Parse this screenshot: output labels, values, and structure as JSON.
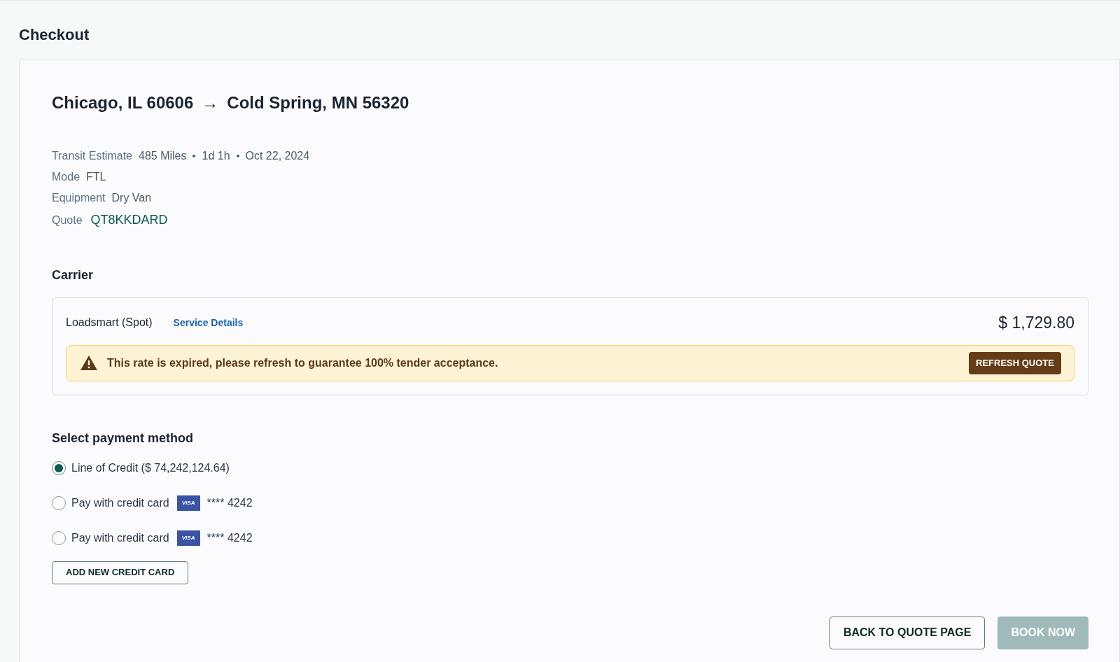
{
  "page_title": "Checkout",
  "route": {
    "origin": "Chicago, IL 60606",
    "arrow": "→",
    "destination": "Cold Spring, MN 56320"
  },
  "details": [
    {
      "label": "Transit Estimate",
      "values": [
        "485 Miles",
        "1d 1h",
        "Oct 22, 2024"
      ],
      "kind": "plain"
    },
    {
      "label": "Mode",
      "values": [
        "FTL"
      ],
      "kind": "plain"
    },
    {
      "label": "Equipment",
      "values": [
        "Dry Van"
      ],
      "kind": "plain"
    },
    {
      "label": "Quote",
      "values": [
        "QT8KKDARD"
      ],
      "kind": "code"
    }
  ],
  "carrier": {
    "heading": "Carrier",
    "name": "Loadsmart (Spot)",
    "link": "Service Details",
    "price": "$ 1,729.80",
    "alert": {
      "message": "This rate is expired, please refresh to guarantee 100% tender acceptance.",
      "button": "REFRESH QUOTE"
    }
  },
  "payment": {
    "heading": "Select payment method",
    "options": [
      {
        "kind": "credit_line",
        "label": "Line of Credit ($ 74,242,124.64)",
        "selected": true
      },
      {
        "kind": "card",
        "label": "Pay with credit card",
        "brand": "VISA",
        "number": "**** 4242",
        "selected": false
      },
      {
        "kind": "card",
        "label": "Pay with credit card",
        "brand": "VISA",
        "number": "**** 4242",
        "selected": false
      }
    ],
    "add_button": "ADD NEW CREDIT CARD"
  },
  "actions": [
    {
      "label": "BACK TO QUOTE PAGE",
      "kind": "secondary",
      "disabled": false
    },
    {
      "label": "BOOK NOW",
      "kind": "primary",
      "disabled": true
    }
  ]
}
